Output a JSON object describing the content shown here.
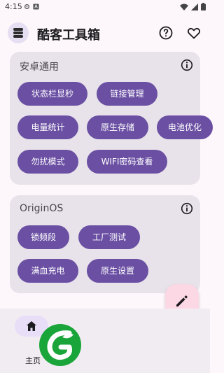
{
  "status_bar": {
    "time": "4:15"
  },
  "app_bar": {
    "title": "酷客工具箱",
    "help_icon": "help-circle-icon",
    "favorite_icon": "heart-outline-icon"
  },
  "sections": [
    {
      "title": "安卓通用",
      "buttons": [
        "状态栏显秒",
        "链接管理",
        "电量统计",
        "原生存储",
        "电池优化",
        "勿扰模式",
        "WIFI密码查看"
      ]
    },
    {
      "title": "OriginOS",
      "buttons": [
        "锁频段",
        "工厂测试",
        "满血充电",
        "原生设置"
      ]
    }
  ],
  "fab": {
    "icon": "edit-pencil-icon"
  },
  "bottom_nav": {
    "home_label": "主页",
    "home_icon": "home-icon"
  },
  "colors": {
    "chip": "#6a4fa3",
    "card": "#e8e3ea",
    "fab": "#fbd8e4",
    "logo_green": "#1aa53a"
  }
}
